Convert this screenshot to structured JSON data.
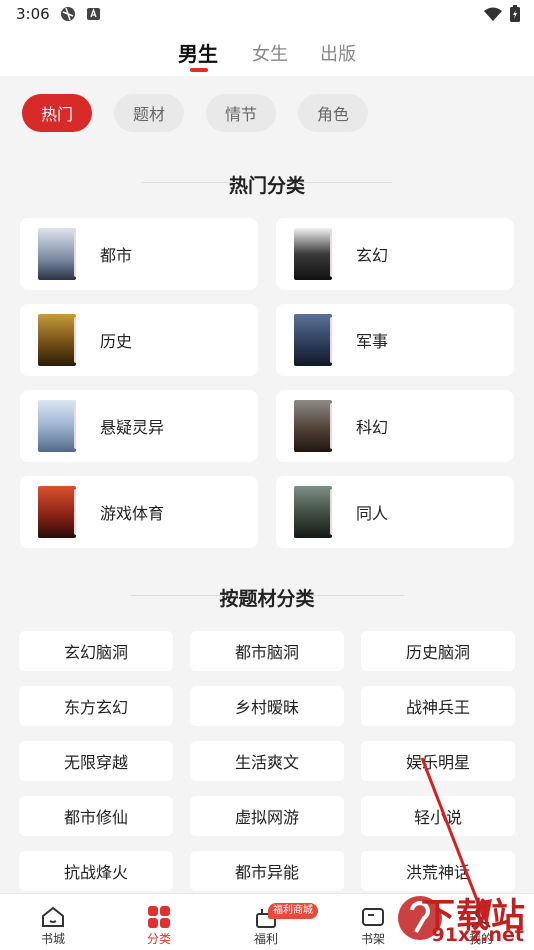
{
  "status": {
    "time": "3:06"
  },
  "tabs": [
    {
      "label": "男生",
      "active": true
    },
    {
      "label": "女生",
      "active": false
    },
    {
      "label": "出版",
      "active": false
    }
  ],
  "chips": [
    {
      "label": "热门",
      "active": true
    },
    {
      "label": "题材",
      "active": false
    },
    {
      "label": "情节",
      "active": false
    },
    {
      "label": "角色",
      "active": false
    }
  ],
  "hot_section": {
    "title": "热门分类",
    "items": [
      {
        "label": "都市",
        "cover_color": "#6b7a8f"
      },
      {
        "label": "玄幻",
        "cover_color": "#2a2a2a"
      },
      {
        "label": "历史",
        "cover_color": "#7a5a1e"
      },
      {
        "label": "军事",
        "cover_color": "#34465f"
      },
      {
        "label": "悬疑灵异",
        "cover_color": "#8ea7c4"
      },
      {
        "label": "科幻",
        "cover_color": "#4a3d36"
      },
      {
        "label": "游戏体育",
        "cover_color": "#8a2316"
      },
      {
        "label": "同人",
        "cover_color": "#3d4a3f"
      }
    ]
  },
  "theme_section": {
    "title": "按题材分类",
    "tags": [
      "玄幻脑洞",
      "都市脑洞",
      "历史脑洞",
      "东方玄幻",
      "乡村暧昧",
      "战神兵王",
      "无限穿越",
      "生活爽文",
      "娱乐明星",
      "都市修仙",
      "虚拟网游",
      "轻小说",
      "抗战烽火",
      "都市异能",
      "洪荒神话"
    ]
  },
  "bottom_nav": {
    "items": [
      {
        "label": "书城",
        "icon": "home-icon",
        "active": false
      },
      {
        "label": "分类",
        "icon": "category-icon",
        "active": true
      },
      {
        "label": "福利",
        "icon": "gift-icon",
        "active": false
      },
      {
        "label": "书架",
        "icon": "bookshelf-icon",
        "active": false
      },
      {
        "label": "我的",
        "icon": "user-icon",
        "active": false
      }
    ],
    "badge": "福利商城"
  },
  "watermark": {
    "line1": "下载站",
    "line2": "91xz.net"
  },
  "colors": {
    "accent": "#d92a2a",
    "background": "#f4f4f4"
  }
}
